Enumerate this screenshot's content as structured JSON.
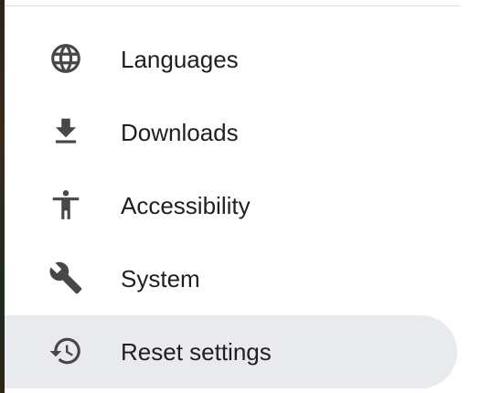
{
  "menu": {
    "items": [
      {
        "label": "Languages",
        "icon": "globe-icon",
        "active": false
      },
      {
        "label": "Downloads",
        "icon": "download-icon",
        "active": false
      },
      {
        "label": "Accessibility",
        "icon": "accessibility-icon",
        "active": false
      },
      {
        "label": "System",
        "icon": "wrench-icon",
        "active": false
      },
      {
        "label": "Reset settings",
        "icon": "history-icon",
        "active": true
      }
    ]
  },
  "colors": {
    "active_background": "#e8eaed",
    "icon_color": "#474747",
    "text_color": "#1f1f1f",
    "divider_color": "#dadce0"
  }
}
